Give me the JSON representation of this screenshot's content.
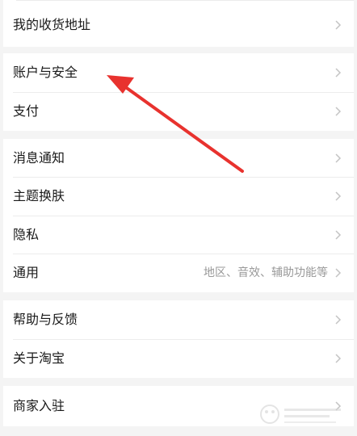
{
  "menu": {
    "groups": [
      {
        "items": [
          {
            "label": "我的收货地址"
          }
        ]
      },
      {
        "items": [
          {
            "label": "账户与安全"
          },
          {
            "label": "支付"
          }
        ]
      },
      {
        "items": [
          {
            "label": "消息通知"
          },
          {
            "label": "主题换肤"
          },
          {
            "label": "隐私"
          },
          {
            "label": "通用",
            "hint": "地区、音效、辅助功能等"
          }
        ]
      },
      {
        "items": [
          {
            "label": "帮助与反馈"
          },
          {
            "label": "关于淘宝"
          }
        ]
      },
      {
        "items": [
          {
            "label": "商家入驻"
          }
        ]
      }
    ]
  },
  "icons": {
    "row_chevron": "chevron-right-icon",
    "annotation": "red-arrow"
  },
  "colors": {
    "background": "#f4f4f4",
    "row_bg": "#ffffff",
    "text": "#1a1a1a",
    "hint": "#999999",
    "chevron": "#c4c4c4",
    "arrow": "#e8322e"
  }
}
